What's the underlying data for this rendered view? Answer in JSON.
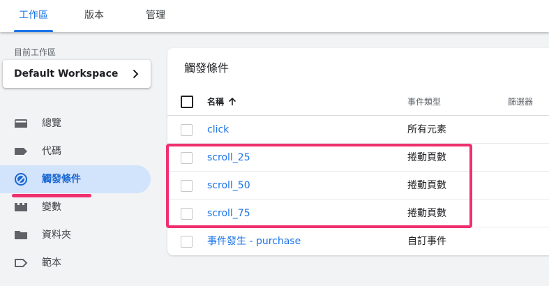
{
  "tabs": [
    {
      "label": "工作區",
      "active": true
    },
    {
      "label": "版本",
      "active": false
    },
    {
      "label": "管理",
      "active": false
    }
  ],
  "sidebar": {
    "workspace_label": "目前工作區",
    "workspace_name": "Default Workspace",
    "items": [
      {
        "label": "總覽",
        "icon": "overview-icon"
      },
      {
        "label": "代碼",
        "icon": "tag-icon"
      },
      {
        "label": "觸發條件",
        "icon": "trigger-icon",
        "active": true
      },
      {
        "label": "變數",
        "icon": "variable-icon"
      },
      {
        "label": "資料夾",
        "icon": "folder-icon"
      },
      {
        "label": "範本",
        "icon": "template-icon"
      }
    ]
  },
  "main": {
    "title": "觸發條件",
    "columns": {
      "name": "名稱",
      "type": "事件類型",
      "filter": "篩選器"
    },
    "rows": [
      {
        "name": "click",
        "type": "所有元素"
      },
      {
        "name": "scroll_25",
        "type": "捲動頁數"
      },
      {
        "name": "scroll_50",
        "type": "捲動頁數"
      },
      {
        "name": "scroll_75",
        "type": "捲動頁數"
      },
      {
        "name": "事件發生 - purchase",
        "type": "自訂事件"
      }
    ]
  },
  "colors": {
    "accent": "#1a73e8",
    "active_nav_bg": "#d2e3fc",
    "highlight": "#f0306e"
  }
}
